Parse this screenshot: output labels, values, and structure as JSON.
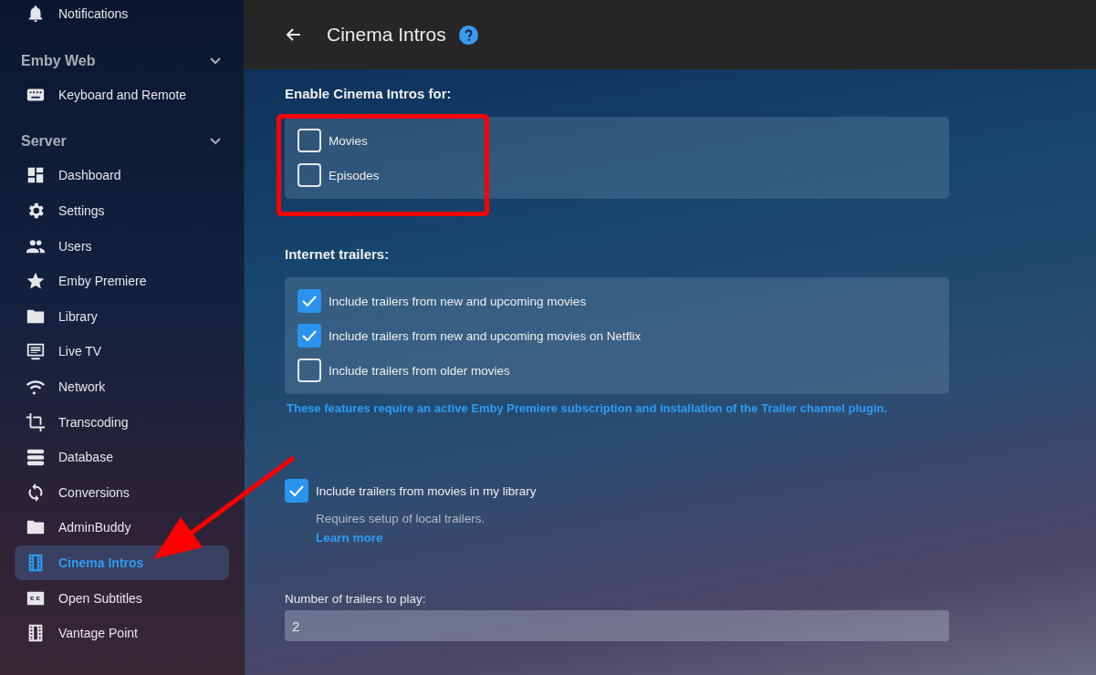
{
  "sidebar": {
    "sections": [
      {
        "items": [
          {
            "label": "Notifications",
            "selected": false
          }
        ]
      },
      {
        "header": "Emby Web",
        "expanded": true,
        "items": [
          {
            "label": "Keyboard and Remote",
            "selected": false
          }
        ]
      },
      {
        "header": "Server",
        "expanded": true,
        "items": [
          {
            "label": "Dashboard",
            "selected": false
          },
          {
            "label": "Settings",
            "selected": false
          },
          {
            "label": "Users",
            "selected": false
          },
          {
            "label": "Emby Premiere",
            "selected": false
          },
          {
            "label": "Library",
            "selected": false
          },
          {
            "label": "Live TV",
            "selected": false
          },
          {
            "label": "Network",
            "selected": false
          },
          {
            "label": "Transcoding",
            "selected": false
          },
          {
            "label": "Database",
            "selected": false
          },
          {
            "label": "Conversions",
            "selected": false
          },
          {
            "label": "AdminBuddy",
            "selected": false
          },
          {
            "label": "Cinema Intros",
            "selected": true
          },
          {
            "label": "Open Subtitles",
            "selected": false
          },
          {
            "label": "Vantage Point",
            "selected": false
          }
        ]
      }
    ]
  },
  "header": {
    "title": "Cinema Intros"
  },
  "content": [
    {
      "kind": "heading",
      "text": "Enable Cinema Intros for:"
    },
    {
      "kind": "panel",
      "items": [
        {
          "label": "Movies",
          "checked": false
        },
        {
          "label": "Episodes",
          "checked": false
        }
      ]
    },
    {
      "kind": "heading",
      "text": "Internet trailers:"
    },
    {
      "kind": "panel",
      "items": [
        {
          "label": "Include trailers from new and upcoming movies",
          "checked": true
        },
        {
          "label": "Include trailers from new and upcoming movies on Netflix",
          "checked": true
        },
        {
          "label": "Include trailers from older movies",
          "checked": false
        }
      ]
    },
    {
      "kind": "note",
      "text": "These features require an active Emby Premiere subscription and installation of the Trailer channel plugin."
    },
    {
      "kind": "checkbox",
      "label": "Include trailers from movies in my library",
      "checked": true,
      "description": "Requires setup of local trailers.",
      "link": "Learn more"
    },
    {
      "kind": "field",
      "label": "Number of trailers to play:",
      "value": "2"
    }
  ],
  "annotations": {
    "highlight_box": true,
    "arrow": true
  }
}
